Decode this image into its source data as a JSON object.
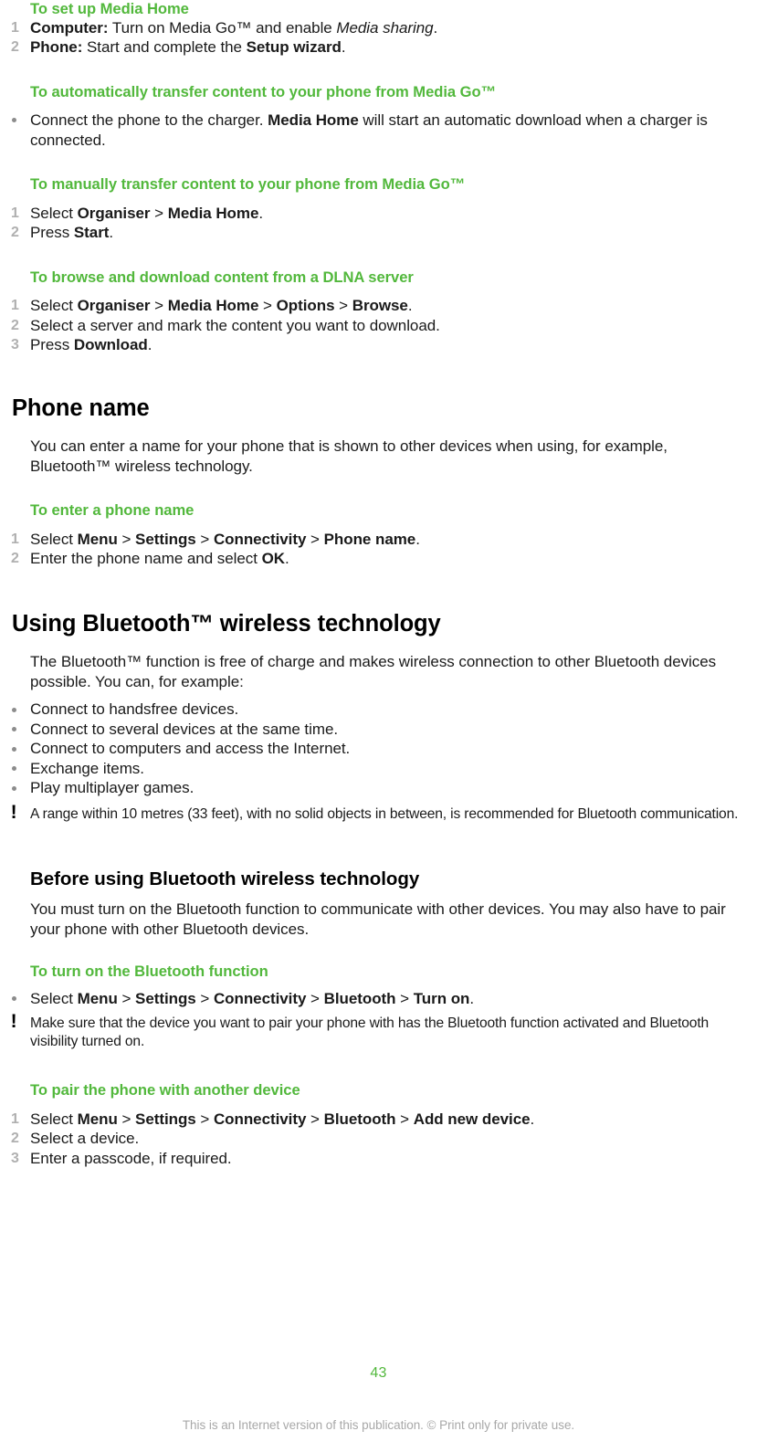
{
  "document": {
    "page_number": "43",
    "footer_note": "This is an Internet version of this publication. © Print only for private use.",
    "accent_green": "#52b83c",
    "marker_gray": "#b0b0b0",
    "bullet_gray": "#8c8c8c",
    "footer_gray": "#a8a8a8"
  },
  "sections": {
    "setup_media_home": {
      "heading": "To set up Media Home",
      "steps": [
        {
          "num": "1",
          "lead": "Computer:",
          "rest": "  Turn on Media Go™ and enable ",
          "emph_italic": "Media sharing",
          "tail": "."
        },
        {
          "num": "2",
          "lead": "Phone:",
          "rest": "  Start and complete the ",
          "emph_bold": "Setup wizard",
          "tail": "."
        }
      ]
    },
    "auto_transfer": {
      "heading": "To automatically transfer content to your phone from Media Go™",
      "bullet_pre": "Connect the phone to the charger. ",
      "bullet_bold": "Media Home",
      "bullet_post": " will start an automatic download when a charger is connected."
    },
    "manual_transfer": {
      "heading": "To manually transfer content to your phone from Media Go™",
      "steps": [
        {
          "num": "1",
          "pre": "Select ",
          "b1": "Organiser",
          "sep1": " > ",
          "b2": "Media Home",
          "tail": "."
        },
        {
          "num": "2",
          "pre": "Press ",
          "b1": "Start",
          "tail": "."
        }
      ]
    },
    "dlna_browse": {
      "heading": "To browse and download content from a DLNA server",
      "steps": [
        {
          "num": "1",
          "pre": "Select ",
          "b1": "Organiser",
          "sep1": " > ",
          "b2": "Media Home",
          "sep2": " > ",
          "b3": "Options",
          "sep3": " > ",
          "b4": "Browse",
          "tail": "."
        },
        {
          "num": "2",
          "plain": "Select a server and mark the content you want to download."
        },
        {
          "num": "3",
          "pre": "Press ",
          "b1": "Download",
          "tail": "."
        }
      ]
    },
    "phone_name": {
      "title": "Phone name",
      "intro": "You can enter a name for your phone that is shown to other devices when using, for example, Bluetooth™ wireless technology.",
      "sub_heading": "To enter a phone name",
      "steps": [
        {
          "num": "1",
          "pre": "Select ",
          "b1": "Menu",
          "sep1": " > ",
          "b2": "Settings",
          "sep2": " > ",
          "b3": "Connectivity",
          "sep3": " > ",
          "b4": "Phone name",
          "tail": "."
        },
        {
          "num": "2",
          "pre": "Enter the phone name and select ",
          "b1": "OK",
          "tail": "."
        }
      ]
    },
    "using_bluetooth": {
      "title": "Using Bluetooth™ wireless technology",
      "intro": "The Bluetooth™ function is free of charge and makes wireless connection to other Bluetooth devices possible. You can, for example:",
      "bullets": [
        "Connect to handsfree devices.",
        "Connect to several devices at the same time.",
        "Connect to computers and access the Internet.",
        "Exchange items.",
        "Play multiplayer games."
      ],
      "note": "A range within 10 metres (33 feet), with no solid objects in between, is recommended for Bluetooth communication."
    },
    "before_using_bluetooth": {
      "title": "Before using Bluetooth wireless technology",
      "intro": "You must turn on the Bluetooth function to communicate with other devices. You may also have to pair your phone with other Bluetooth devices.",
      "turn_on": {
        "heading": "To turn on the Bluetooth function",
        "bullet": {
          "pre": "Select ",
          "b1": "Menu",
          "sep1": " > ",
          "b2": "Settings",
          "sep2": " > ",
          "b3": "Connectivity",
          "sep3": " > ",
          "b4": "Bluetooth",
          "sep4": " > ",
          "b5": "Turn on",
          "tail": "."
        }
      },
      "note": "Make sure that the device you want to pair your phone with has the Bluetooth function activated and Bluetooth visibility turned on.",
      "pair": {
        "heading": "To pair the phone with another device",
        "steps": [
          {
            "num": "1",
            "pre": "Select ",
            "b1": "Menu",
            "sep1": " > ",
            "b2": "Settings",
            "sep2": " > ",
            "b3": "Connectivity",
            "sep3": " > ",
            "b4": "Bluetooth",
            "sep4": " > ",
            "b5": "Add new device",
            "tail": "."
          },
          {
            "num": "2",
            "plain": "Select a device."
          },
          {
            "num": "3",
            "plain": "Enter a passcode, if required."
          }
        ]
      }
    }
  }
}
